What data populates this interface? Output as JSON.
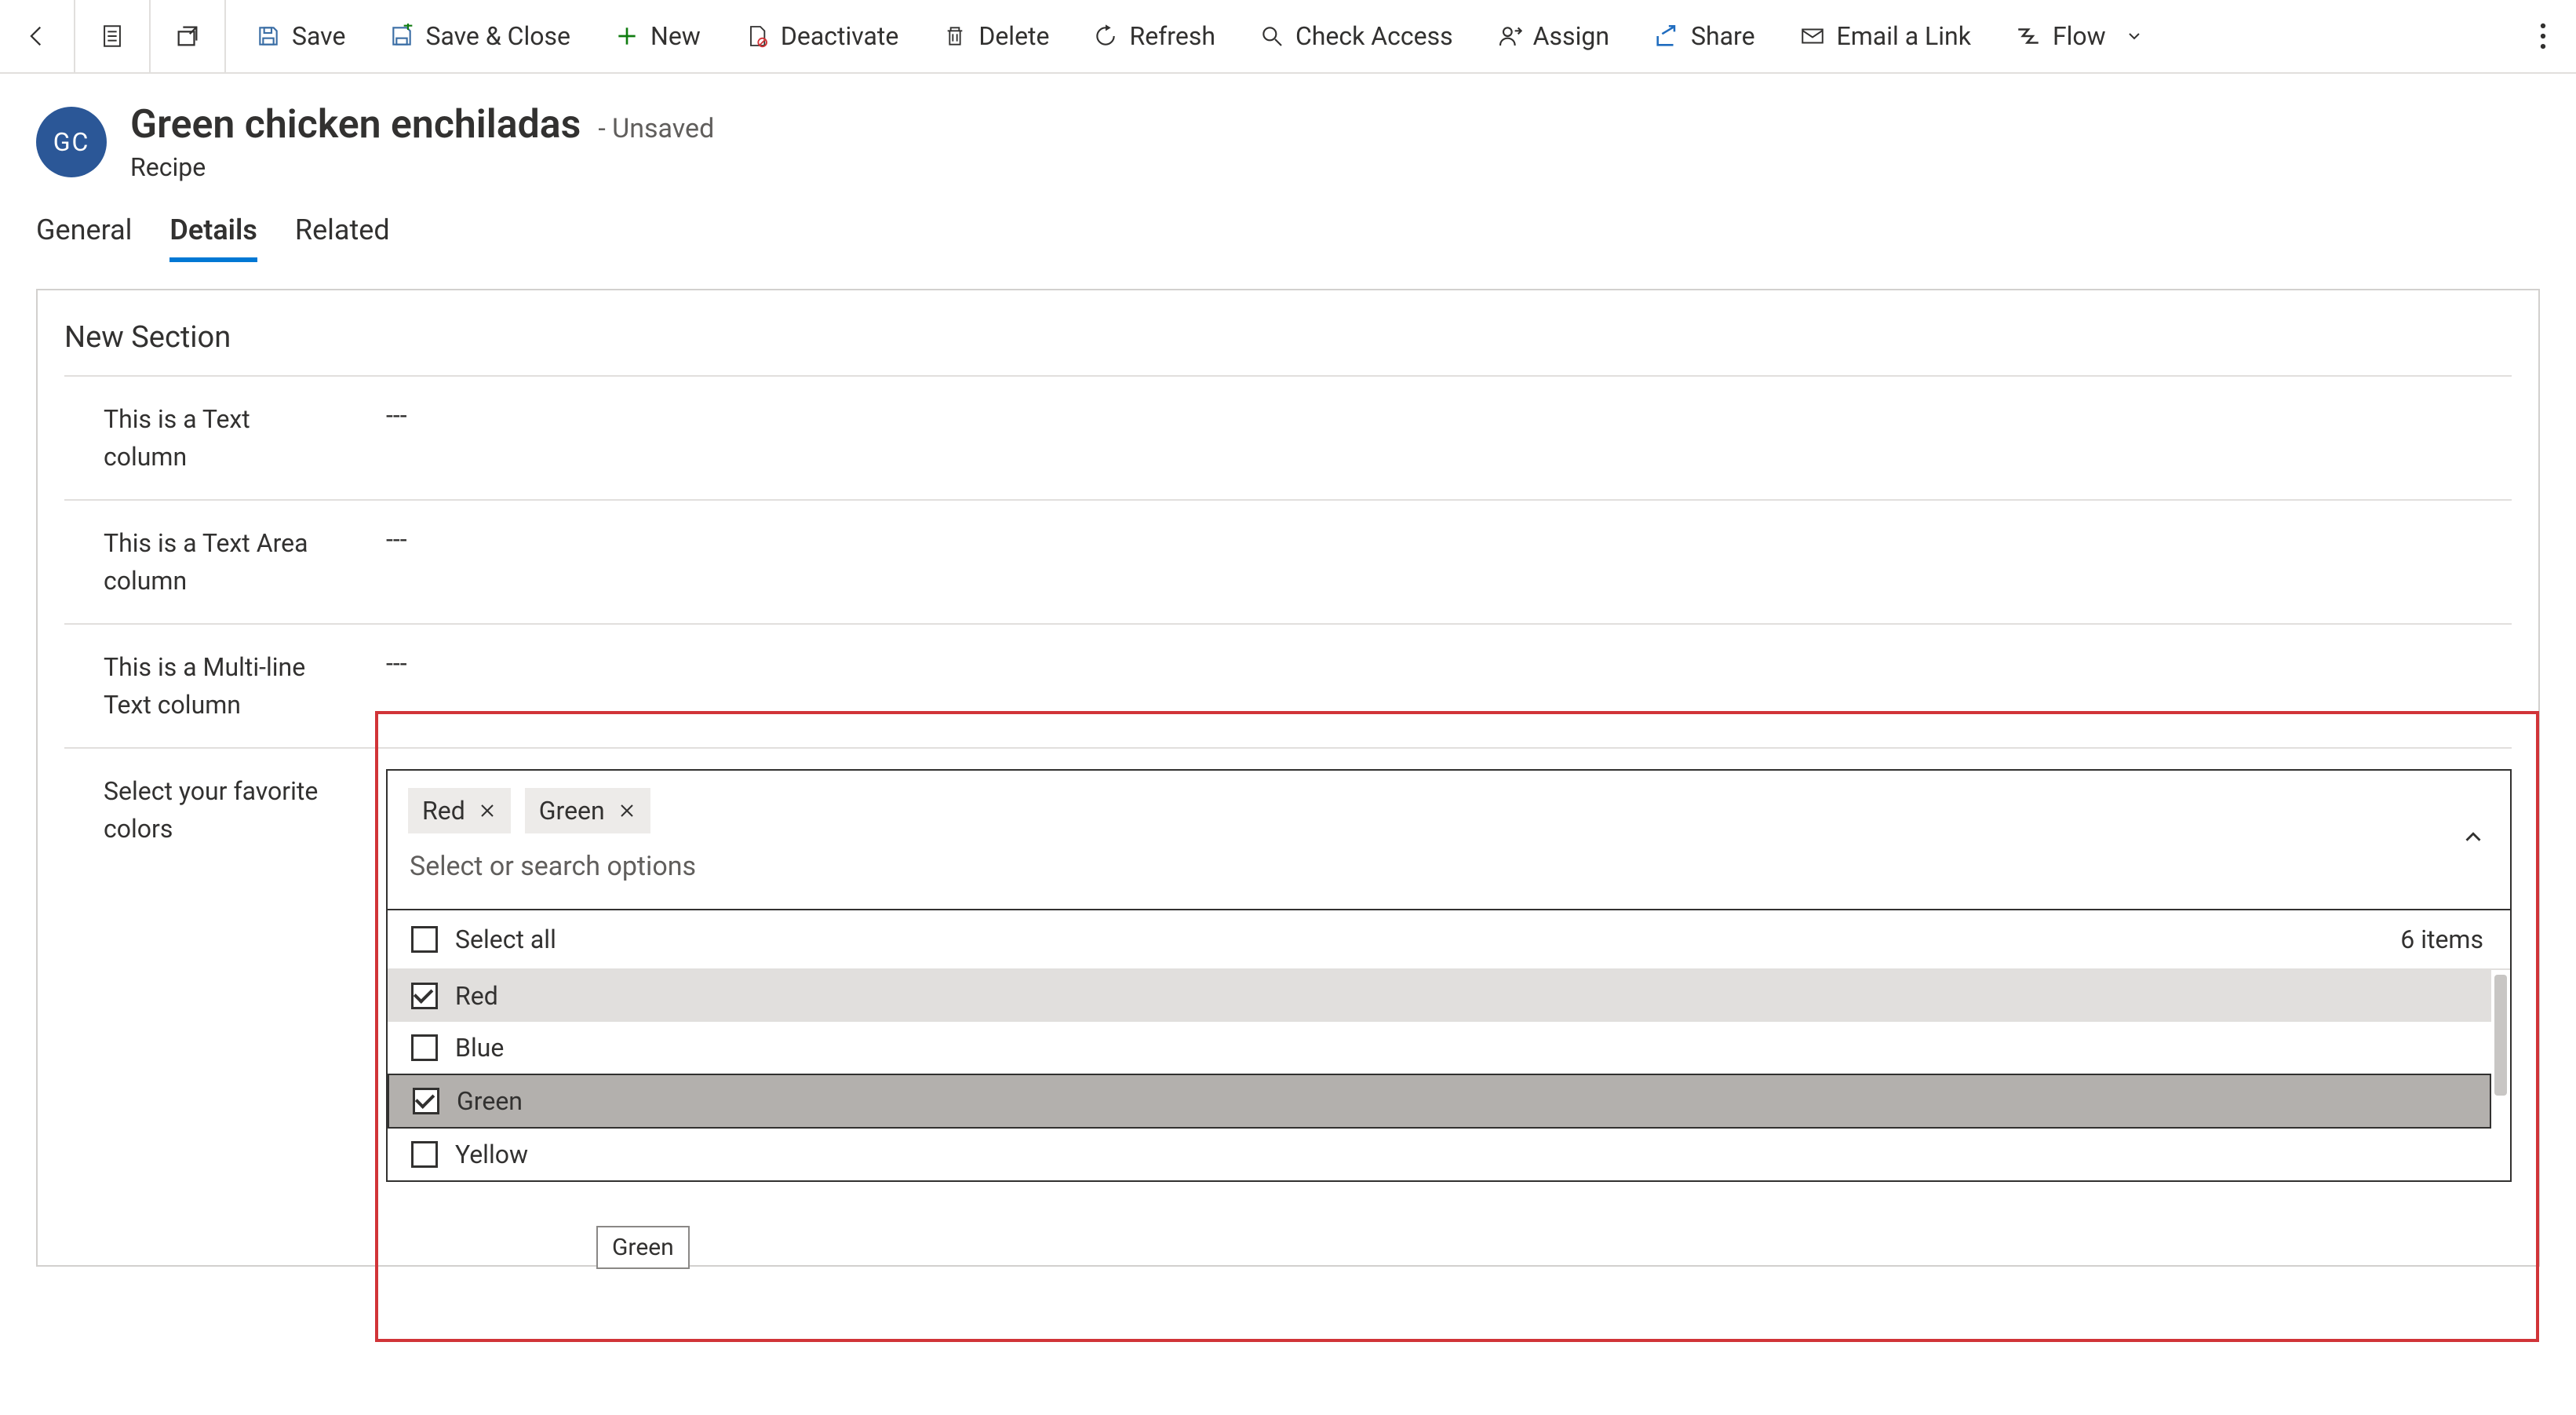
{
  "commandbar": {
    "save": "Save",
    "save_close": "Save & Close",
    "new": "New",
    "deactivate": "Deactivate",
    "delete": "Delete",
    "refresh": "Refresh",
    "check_access": "Check Access",
    "assign": "Assign",
    "share": "Share",
    "email_link": "Email a Link",
    "flow": "Flow"
  },
  "record": {
    "avatar_initials": "GC",
    "title": "Green chicken enchiladas",
    "status": "- Unsaved",
    "subtitle": "Recipe"
  },
  "tabs": {
    "general": "General",
    "details": "Details",
    "related": "Related"
  },
  "section": {
    "title": "New Section",
    "fields": {
      "text_label": "This is a Text column",
      "text_value": "---",
      "textarea_label": "This is a Text Area column",
      "textarea_value": "---",
      "multiline_label": "This is a Multi-line Text column",
      "multiline_value": "---",
      "colors_label": "Select your favorite colors"
    }
  },
  "multiselect": {
    "chips": {
      "0": "Red",
      "1": "Green"
    },
    "placeholder": "Select or search options",
    "select_all": "Select all",
    "count_text": "6 items",
    "options": {
      "0": "Red",
      "1": "Blue",
      "2": "Green",
      "3": "Yellow"
    },
    "tooltip": "Green"
  }
}
